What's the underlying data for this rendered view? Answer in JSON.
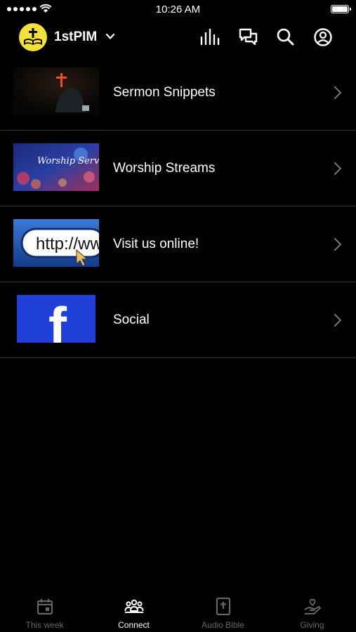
{
  "status_bar": {
    "time": "10:26 AM"
  },
  "header": {
    "title": "1stPIM",
    "icons": [
      "equalizer-icon",
      "chat-icon",
      "search-icon",
      "account-icon"
    ]
  },
  "list": {
    "items": [
      {
        "label": "Sermon Snippets",
        "thumb": "sermon-thumbnail"
      },
      {
        "label": "Worship Streams",
        "thumb": "worship-thumbnail",
        "thumb_text": "Worship Service"
      },
      {
        "label": "Visit us online!",
        "thumb": "website-thumbnail",
        "thumb_text": "http://www."
      },
      {
        "label": "Social",
        "thumb": "facebook-thumbnail",
        "thumb_text": "f"
      }
    ]
  },
  "tabbar": {
    "tabs": [
      {
        "label": "This week",
        "icon": "calendar-icon",
        "active": false
      },
      {
        "label": "Connect",
        "icon": "people-icon",
        "active": true
      },
      {
        "label": "Audio Bible",
        "icon": "bible-icon",
        "active": false
      },
      {
        "label": "Giving",
        "icon": "giving-hand-icon",
        "active": false
      }
    ]
  },
  "colors": {
    "background": "#000000",
    "logo_yellow": "#f2e13a",
    "facebook_blue": "#1f3fd6",
    "inactive_tab": "#666666"
  }
}
